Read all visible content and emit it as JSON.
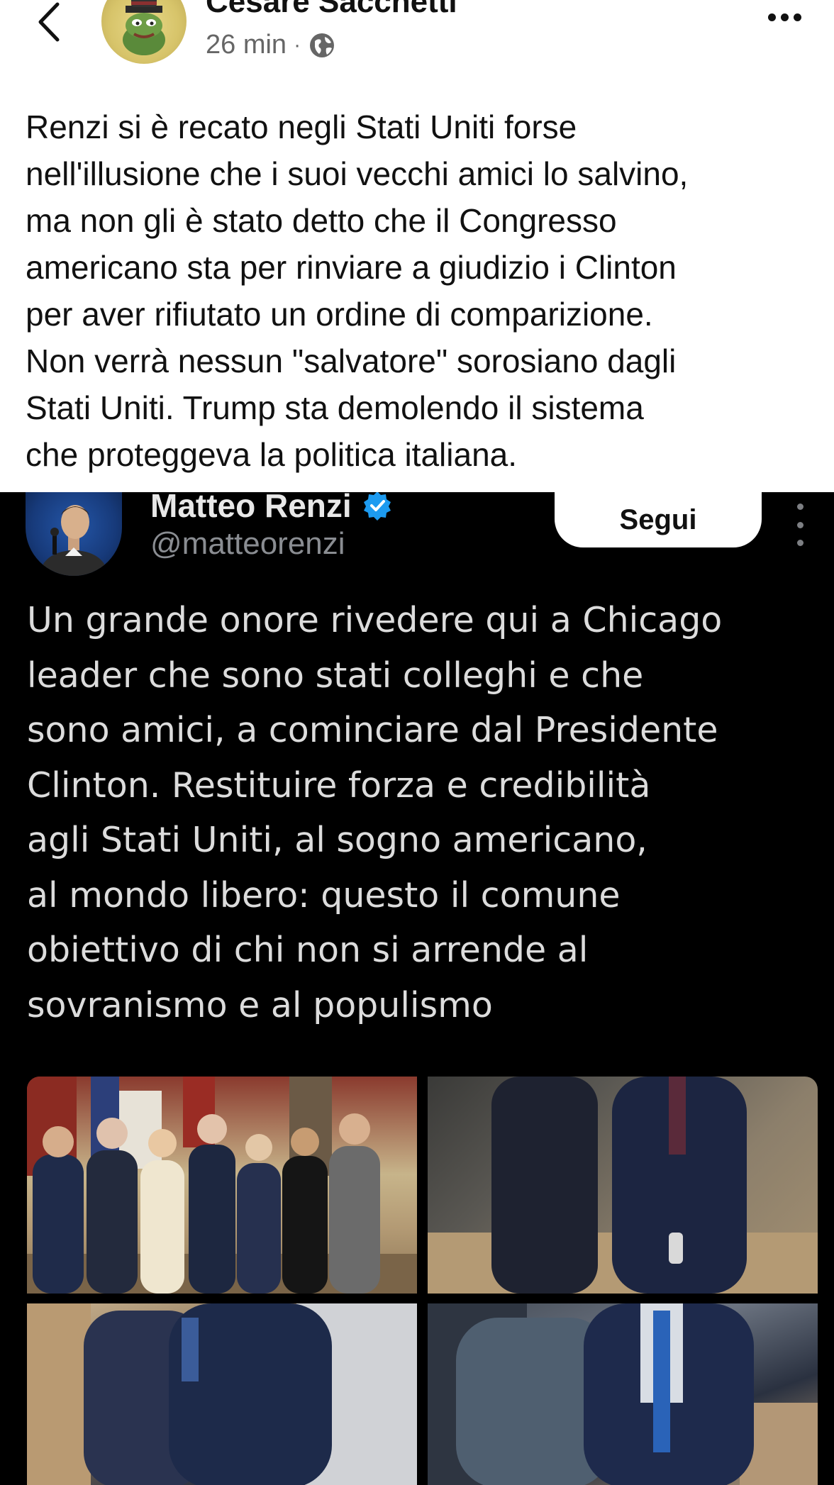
{
  "post": {
    "author": "Cesare Sacchetti",
    "time": "26 min",
    "separator": "·",
    "visibility_icon": "globe-icon",
    "text": "Renzi si è recato negli Stati Uniti forse\nnell'illusione che i suoi vecchi amici lo salvino,\nma non gli è stato detto che il Congresso\namericano sta per rinviare a giudizio i Clinton\nper aver rifiutato un ordine di comparizione.\nNon verrà nessun \"salvatore\" sorosiano dagli\nStati Uniti. Trump sta demolendo il sistema\nche proteggeva la politica italiana."
  },
  "tweet": {
    "name": "Matteo Renzi",
    "verified_color": "#1d9bf0",
    "handle": "@matteorenzi",
    "follow_label": "Segui",
    "text": "Un grande onore rivedere qui a Chicago\nleader che sono stati colleghi e che\nsono amici, a cominciare dal Presidente\nClinton. Restituire forza e credibilità\nagli Stati Uniti, al sogno americano,\nal mondo libero: questo il comune\nobiettivo di chi non si arrende al\nsovranismo e al populismo",
    "photo_count": 4
  },
  "colors": {
    "post_background": "#ffffff",
    "tweet_background": "#000000",
    "follow_button": "#ffffff"
  }
}
